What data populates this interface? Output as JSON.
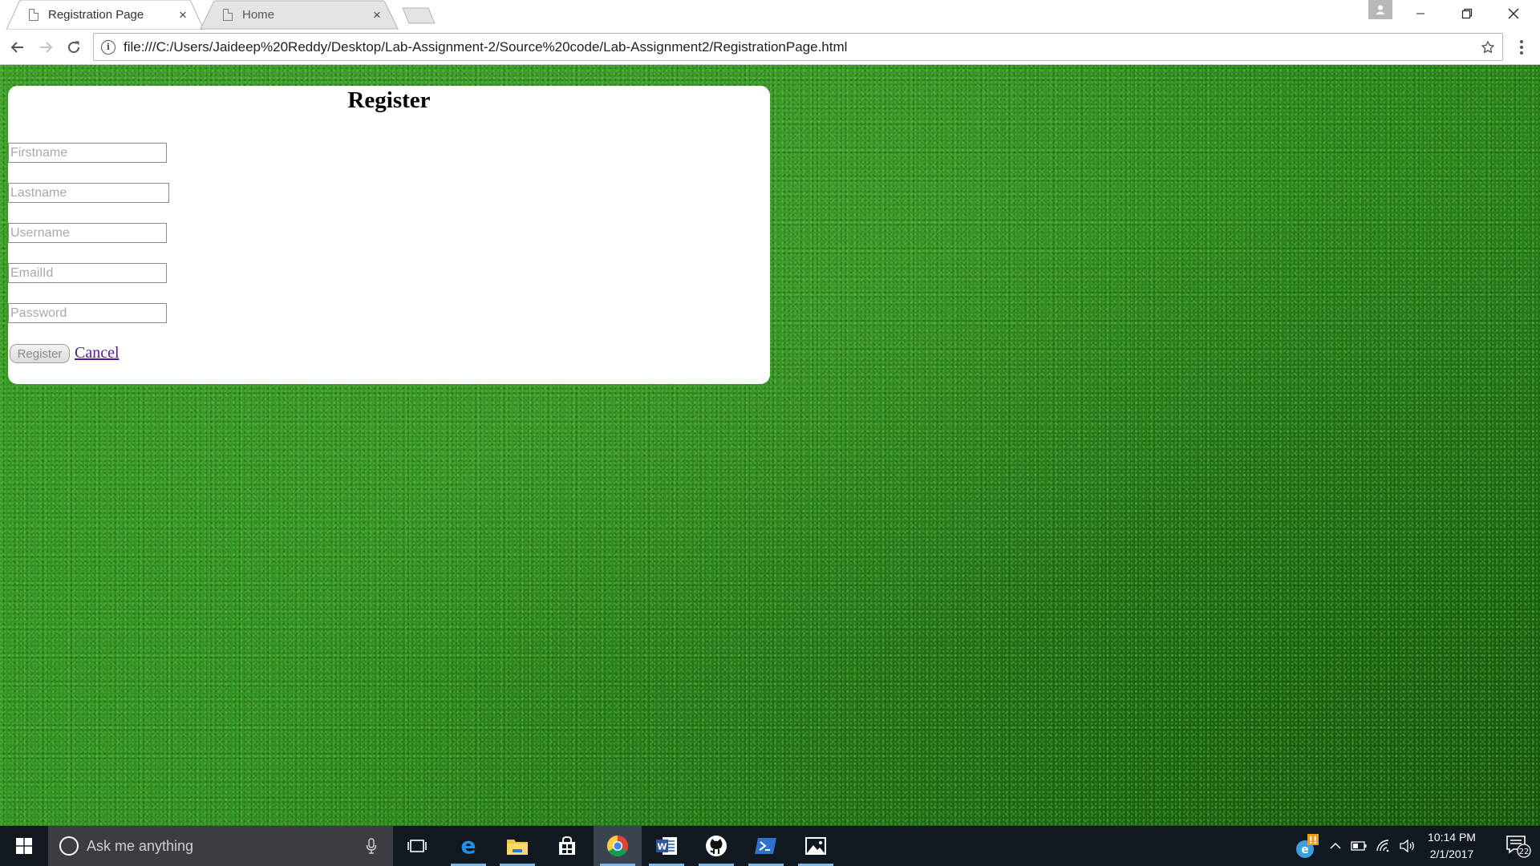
{
  "browser": {
    "tabs": [
      {
        "title": "Registration Page",
        "close": "×"
      },
      {
        "title": "Home",
        "close": "×"
      }
    ],
    "address_bar": {
      "url": "file:///C:/Users/Jaideep%20Reddy/Desktop/Lab-Assignment-2/Source%20code/Lab-Assignment2/RegistrationPage.html"
    },
    "info_glyph": "i"
  },
  "form": {
    "heading": "Register",
    "fields": [
      {
        "placeholder": "Firstname",
        "value": ""
      },
      {
        "placeholder": "Lastname",
        "value": ""
      },
      {
        "placeholder": "Username",
        "value": ""
      },
      {
        "placeholder": "EmailId",
        "value": ""
      },
      {
        "placeholder": "Password",
        "value": ""
      }
    ],
    "register_label": "Register",
    "cancel_label": "Cancel",
    "card_background": "#ffffff",
    "page_background": "#2f8f1f",
    "link_color": "#551a8b"
  },
  "taskbar": {
    "search_placeholder": "Ask me anything",
    "apps": [
      "task-view-icon",
      "edge-icon",
      "file-explorer-icon",
      "store-icon",
      "chrome-icon",
      "word-icon",
      "github-icon",
      "powershell-icon",
      "photos-icon"
    ],
    "notification_badge": "!!",
    "clock_time": "10:14 PM",
    "clock_date": "2/1/2017",
    "notification_count": "22"
  }
}
